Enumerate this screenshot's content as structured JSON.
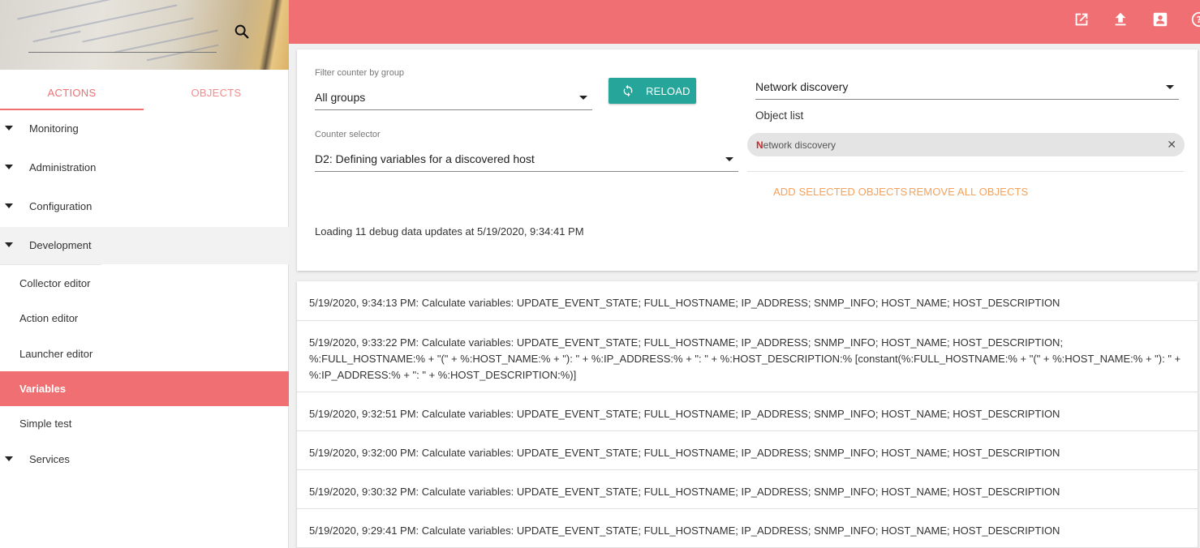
{
  "sidebar": {
    "tabs": {
      "actions": "ACTIONS",
      "objects": "OBJECTS"
    },
    "groups": [
      {
        "label": "Monitoring"
      },
      {
        "label": "Administration"
      },
      {
        "label": "Configuration"
      },
      {
        "label": "Development"
      },
      {
        "label": "Services"
      }
    ],
    "items": [
      {
        "label": "Collector editor"
      },
      {
        "label": "Action editor"
      },
      {
        "label": "Launcher editor"
      },
      {
        "label": "Variables"
      },
      {
        "label": "Simple test"
      }
    ],
    "selected_item": "Variables"
  },
  "topbar": {
    "icons": [
      "open-in-new-icon",
      "upload-icon",
      "account-box-icon",
      "help-icon"
    ],
    "color": "#ef6f72"
  },
  "filter": {
    "group_label": "Filter counter by group",
    "group_value": "All groups",
    "reload_label": "RELOAD",
    "counter_label": "Counter selector",
    "counter_value": "D2: Defining variables for a discovered host",
    "object_select_value": "Network discovery",
    "object_list_label": "Object list",
    "chip_first_letter": "N",
    "chip_rest": "etwork discovery",
    "add_label": "ADD SELECTED OBJECTS",
    "remove_label": "REMOVE ALL OBJECTS",
    "status": "Loading 11 debug data updates at 5/19/2020, 9:34:41 PM"
  },
  "log": [
    "5/19/2020, 9:34:13 PM: Calculate variables: UPDATE_EVENT_STATE; FULL_HOSTNAME; IP_ADDRESS; SNMP_INFO; HOST_NAME; HOST_DESCRIPTION",
    "5/19/2020, 9:33:22 PM: Calculate variables: UPDATE_EVENT_STATE; FULL_HOSTNAME; IP_ADDRESS; SNMP_INFO; HOST_NAME; HOST_DESCRIPTION; %:FULL_HOSTNAME:% + \"(\" + %:HOST_NAME:% + \"): \" + %:IP_ADDRESS:% + \": \" + %:HOST_DESCRIPTION:% [constant(%:FULL_HOSTNAME:% + \"(\" + %:HOST_NAME:% + \"): \" + %:IP_ADDRESS:% + \": \" + %:HOST_DESCRIPTION:%)]",
    "5/19/2020, 9:32:51 PM: Calculate variables: UPDATE_EVENT_STATE; FULL_HOSTNAME; IP_ADDRESS; SNMP_INFO; HOST_NAME; HOST_DESCRIPTION",
    "5/19/2020, 9:32:00 PM: Calculate variables: UPDATE_EVENT_STATE; FULL_HOSTNAME; IP_ADDRESS; SNMP_INFO; HOST_NAME; HOST_DESCRIPTION",
    "5/19/2020, 9:30:32 PM: Calculate variables: UPDATE_EVENT_STATE; FULL_HOSTNAME; IP_ADDRESS; SNMP_INFO; HOST_NAME; HOST_DESCRIPTION",
    "5/19/2020, 9:29:41 PM: Calculate variables: UPDATE_EVENT_STATE; FULL_HOSTNAME; IP_ADDRESS; SNMP_INFO; HOST_NAME; HOST_DESCRIPTION"
  ],
  "colors": {
    "accent": "#ef6f72",
    "teal": "#26a69a",
    "orange_link": "#f5a25d"
  }
}
